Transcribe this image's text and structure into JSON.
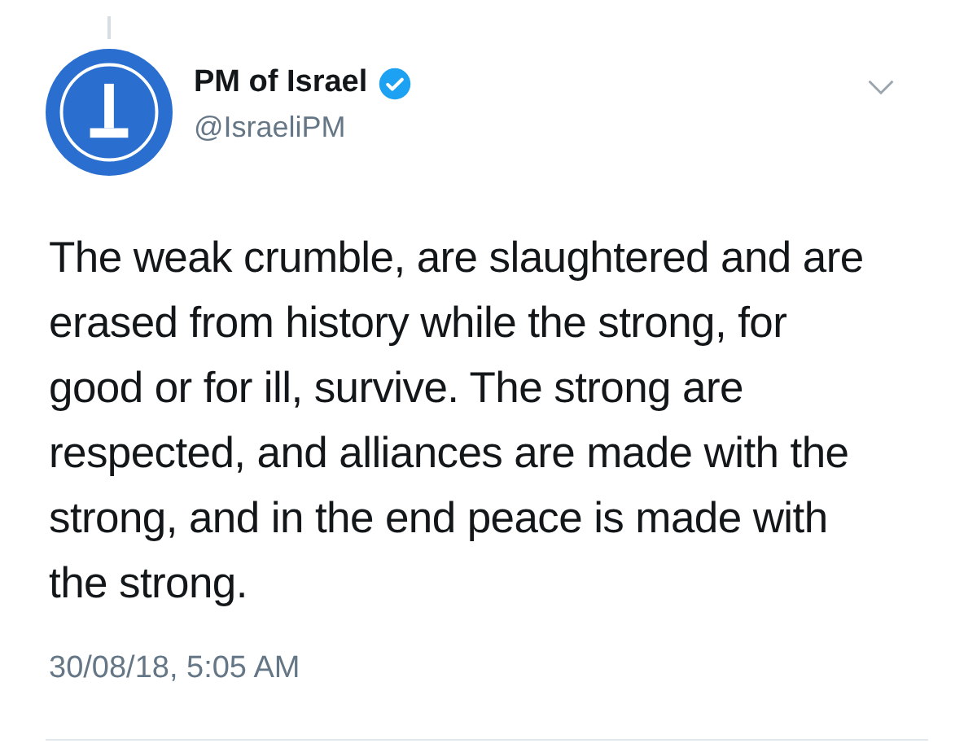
{
  "tweet": {
    "author": {
      "name": "PM of Israel",
      "handle": "@IsraeliPM",
      "verified": true
    },
    "text": "The weak crumble, are slaughtered and are erased from history while the strong, for good or for ill, survive. The strong are respected, and alliances are made with the strong, and in the end peace is made with the strong.",
    "timestamp": "30/08/18, 5:05 AM"
  }
}
